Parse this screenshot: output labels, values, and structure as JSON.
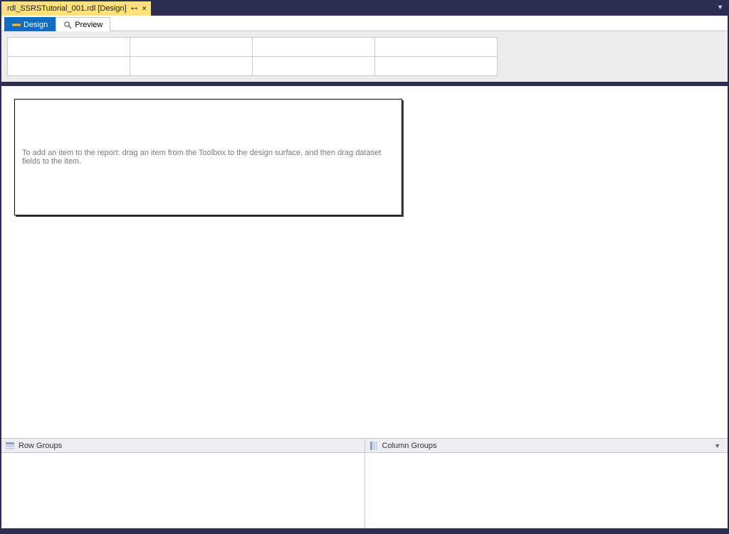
{
  "doc_tab": {
    "title": "rdl_SSRSTutorial_001.rdl [Design]"
  },
  "view_tabs": {
    "design": "Design",
    "preview": "Preview"
  },
  "report_hint": "To add an item to the report: drag an item from the Toolbox to the design surface, and then drag dataset fields to the item.",
  "groups": {
    "row_label": "Row Groups",
    "col_label": "Column Groups"
  }
}
